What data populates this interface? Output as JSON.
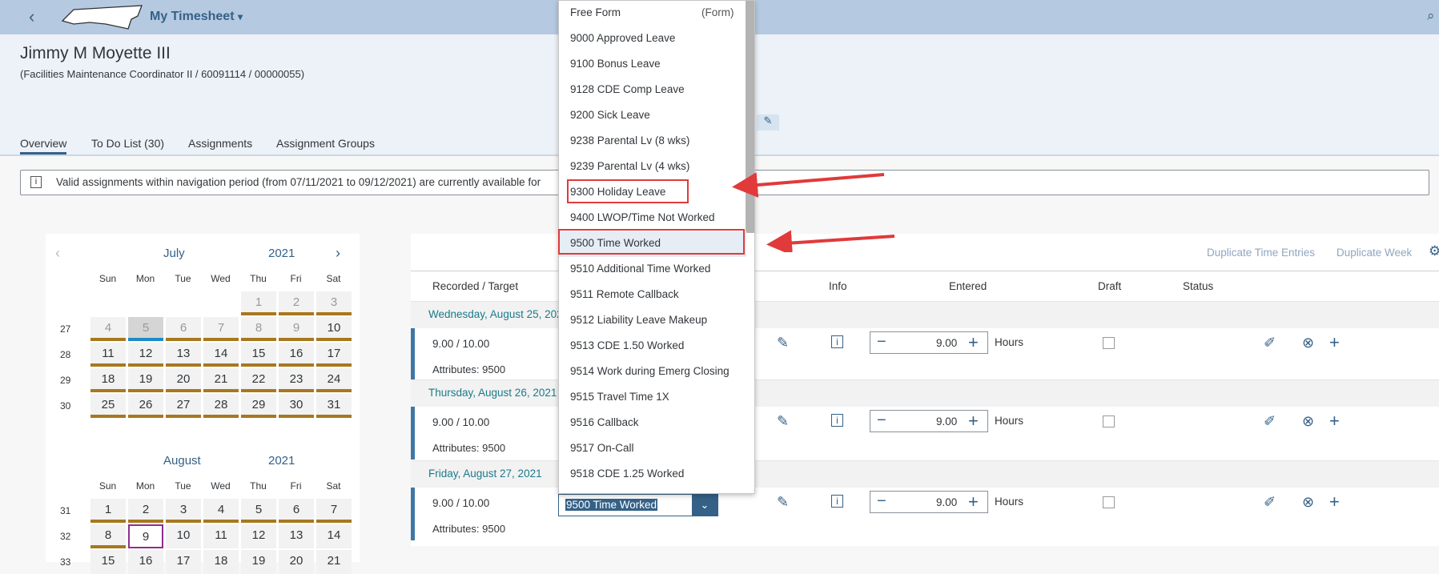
{
  "shell": {
    "title": "My Timesheet",
    "title_arrow": "▾",
    "logo": "North Carolina state outline"
  },
  "employee": {
    "name": "Jimmy M Moyette III",
    "details": "(Facilities Maintenance Coordinator II / 60091114 / 00000055)"
  },
  "tabs": [
    {
      "label": "Overview"
    },
    {
      "label": "To Do List (30)"
    },
    {
      "label": "Assignments"
    },
    {
      "label": "Assignment Groups"
    }
  ],
  "info_message": "Valid assignments within navigation period (from 07/11/2021 to 09/12/2021) are currently available for",
  "calendar": {
    "weekdays": [
      "Sun",
      "Mon",
      "Tue",
      "Wed",
      "Thu",
      "Fri",
      "Sat"
    ],
    "months": [
      {
        "month": "July",
        "year": "2021",
        "weeks": [
          {
            "wk": "",
            "days": [
              "",
              "",
              "",
              "",
              "1",
              "2",
              "3"
            ]
          },
          {
            "wk": "27",
            "days": [
              "4",
              "5",
              "6",
              "7",
              "8",
              "9",
              "10"
            ]
          },
          {
            "wk": "28",
            "days": [
              "11",
              "12",
              "13",
              "14",
              "15",
              "16",
              "17"
            ]
          },
          {
            "wk": "29",
            "days": [
              "18",
              "19",
              "20",
              "21",
              "22",
              "23",
              "24"
            ]
          },
          {
            "wk": "30",
            "days": [
              "25",
              "26",
              "27",
              "28",
              "29",
              "30",
              "31"
            ]
          }
        ]
      },
      {
        "month": "August",
        "year": "2021",
        "weeks": [
          {
            "wk": "31",
            "days": [
              "1",
              "2",
              "3",
              "4",
              "5",
              "6",
              "7"
            ]
          },
          {
            "wk": "32",
            "days": [
              "8",
              "9",
              "10",
              "11",
              "12",
              "13",
              "14"
            ]
          },
          {
            "wk": "33",
            "days": [
              "15",
              "16",
              "17",
              "18",
              "19",
              "20",
              "21"
            ]
          }
        ]
      }
    ]
  },
  "toolbar": {
    "duplicate_entries": "Duplicate Time Entries",
    "duplicate_week": "Duplicate Week"
  },
  "columns": {
    "recorded": "Recorded / Target",
    "info": "Info",
    "entered": "Entered",
    "draft": "Draft",
    "status": "Status"
  },
  "days": [
    {
      "date": "Wednesday, August 25, 2021",
      "recorded": "9.00 / 10.00",
      "attributes_label": "Attributes:",
      "attributes": "9500",
      "hours": "9.00",
      "unit": "Hours"
    },
    {
      "date": "Thursday, August 26, 2021",
      "recorded": "9.00 / 10.00",
      "attributes_label": "Attributes:",
      "attributes": "9500",
      "hours": "9.00",
      "unit": "Hours"
    },
    {
      "date": "Friday, August 27, 2021",
      "recorded": "9.00 / 10.00",
      "attributes_label": "Attributes:",
      "attributes": "9500",
      "hours": "9.00",
      "unit": "Hours",
      "combo_value": "9500 Time Worked"
    }
  ],
  "dropdown": {
    "items": [
      {
        "label": "Free Form",
        "note": "(Form)"
      },
      {
        "label": "9000 Approved Leave"
      },
      {
        "label": "9100 Bonus Leave"
      },
      {
        "label": "9128 CDE Comp Leave"
      },
      {
        "label": "9200 Sick Leave"
      },
      {
        "label": "9238 Parental Lv (8 wks)"
      },
      {
        "label": "9239 Parental Lv (4 wks)"
      },
      {
        "label": "9300 Holiday Leave"
      },
      {
        "label": "9400 LWOP/Time Not Worked"
      },
      {
        "label": "9500 Time Worked"
      },
      {
        "label": "9510 Additional Time Worked"
      },
      {
        "label": "9511 Remote Callback"
      },
      {
        "label": "9512 Liability Leave Makeup"
      },
      {
        "label": "9513 CDE 1.50 Worked"
      },
      {
        "label": "9514 Work during Emerg Closing"
      },
      {
        "label": "9515 Travel Time 1X"
      },
      {
        "label": "9516 Callback"
      },
      {
        "label": "9517 On-Call"
      },
      {
        "label": "9518 CDE 1.25 Worked"
      }
    ]
  },
  "colors": {
    "accent": "#346187",
    "shell": "#b5cae1",
    "bar": "#a8781e",
    "annotation": "#e03a3a"
  }
}
